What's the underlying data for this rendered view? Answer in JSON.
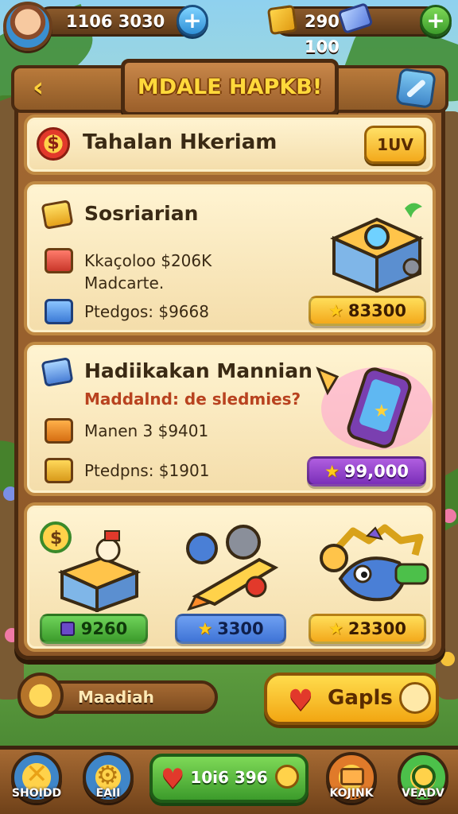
{
  "top_bar": {
    "coins_value": "1106 3030",
    "gold_value": "290",
    "gems_value": "100",
    "plus_label": "+"
  },
  "header": {
    "title": "MDALE HAPKB!",
    "back_icon": "chevron-left-icon",
    "tool_icon": "wrench-icon"
  },
  "intro": {
    "title": "Tahalan Hkeriam",
    "button_label": "1UV"
  },
  "offers": [
    {
      "title": "Sosriarian",
      "line1": "Kkaçoloo $206K",
      "line1b": "Madcarte.",
      "line2": "Ptedgos: $9668",
      "price": "83300"
    },
    {
      "title": "Hadiikakan Mannian",
      "subtitle": "Maddalnd: de sledmies?",
      "line1": "Manen 3 $9401",
      "line2": "Ptedpns: $1901",
      "price": "99,000"
    }
  ],
  "bundles": [
    {
      "price": "9260",
      "color": "#45b83a"
    },
    {
      "price": "3300",
      "color": "#3f74d6"
    },
    {
      "price": "23300",
      "color": "#f3a91b"
    }
  ],
  "bottom": {
    "left_label": "Maadiah",
    "right_label": "Gapls"
  },
  "nav": {
    "items": [
      {
        "label": "SHOIDD"
      },
      {
        "label": "EAII"
      },
      {
        "label": "10i6 396"
      },
      {
        "label": "KOJINK"
      },
      {
        "label": "VEADV"
      }
    ]
  }
}
